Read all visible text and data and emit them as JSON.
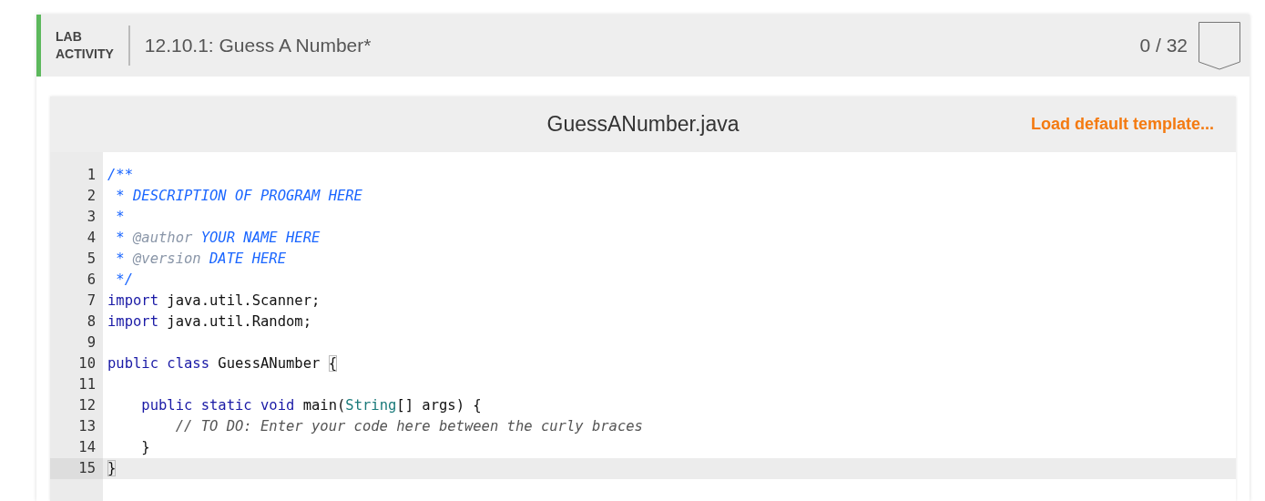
{
  "activity": {
    "label_lines": [
      "LAB",
      "ACTIVITY"
    ],
    "title": "12.10.1: Guess A Number*",
    "score": "0 / 32"
  },
  "editor": {
    "filename": "GuessANumber.java",
    "load_template": "Load default template...",
    "lines": [
      {
        "number": "1",
        "active": false,
        "tokens": [
          {
            "text": "/**",
            "kind": "comment"
          }
        ]
      },
      {
        "number": "2",
        "active": false,
        "tokens": [
          {
            "text": " * DESCRIPTION OF PROGRAM HERE",
            "kind": "comment"
          }
        ]
      },
      {
        "number": "3",
        "active": false,
        "tokens": [
          {
            "text": " *",
            "kind": "comment"
          }
        ]
      },
      {
        "number": "4",
        "active": false,
        "tokens": [
          {
            "text": " * ",
            "kind": "comment"
          },
          {
            "text": "@author",
            "kind": "tag"
          },
          {
            "text": " YOUR NAME HERE",
            "kind": "comment"
          }
        ]
      },
      {
        "number": "5",
        "active": false,
        "tokens": [
          {
            "text": " * ",
            "kind": "comment"
          },
          {
            "text": "@version",
            "kind": "tag"
          },
          {
            "text": " DATE HERE",
            "kind": "comment"
          }
        ]
      },
      {
        "number": "6",
        "active": false,
        "tokens": [
          {
            "text": " */",
            "kind": "comment"
          }
        ]
      },
      {
        "number": "7",
        "active": false,
        "tokens": [
          {
            "text": "import",
            "kind": "keyword"
          },
          {
            "text": " java.util.Scanner;",
            "kind": "plain"
          }
        ]
      },
      {
        "number": "8",
        "active": false,
        "tokens": [
          {
            "text": "import",
            "kind": "keyword"
          },
          {
            "text": " java.util.Random;",
            "kind": "plain"
          }
        ]
      },
      {
        "number": "9",
        "active": false
      },
      {
        "number": "10",
        "active": false,
        "tokens": [
          {
            "text": "public class",
            "kind": "keyword"
          },
          {
            "text": " GuessANumber ",
            "kind": "plain"
          },
          {
            "text": "{",
            "kind": "match"
          }
        ]
      },
      {
        "number": "11",
        "active": false
      },
      {
        "number": "12",
        "active": false,
        "tokens": [
          {
            "text": "    public static void",
            "kind": "keyword"
          },
          {
            "text": " main(",
            "kind": "plain"
          },
          {
            "text": "String",
            "kind": "type"
          },
          {
            "text": "[] args) {",
            "kind": "plain"
          }
        ]
      },
      {
        "number": "13",
        "active": false,
        "tokens": [
          {
            "text": "        // TO DO: Enter your code here between the curly braces",
            "kind": "linecomment"
          }
        ]
      },
      {
        "number": "14",
        "active": false,
        "tokens": [
          {
            "text": "    }",
            "kind": "plain"
          }
        ]
      },
      {
        "number": "15",
        "active": true,
        "tokens": [
          {
            "text": "}",
            "kind": "match"
          }
        ]
      }
    ]
  }
}
